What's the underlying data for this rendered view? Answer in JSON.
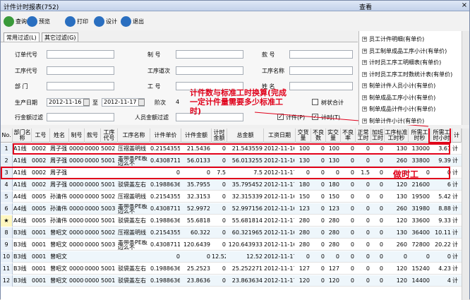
{
  "window": {
    "title": "计件计时报表(752)",
    "query_label": "查看",
    "close_glyph": "×"
  },
  "toolbar": [
    {
      "label": "查询",
      "icon": "search-icon",
      "color": "#3a9a3a"
    },
    {
      "label": "预览",
      "icon": "preview-icon",
      "color": "#2a6fc0"
    },
    {
      "label": "打印",
      "icon": "print-icon",
      "color": "#2a6fc0"
    },
    {
      "label": "设计",
      "icon": "design-icon",
      "color": "#2a6fc0"
    },
    {
      "label": "退出",
      "icon": "exit-icon",
      "color": "#2a6fc0"
    }
  ],
  "tabs": [
    "常用过滤(L)",
    "其它过滤(G)"
  ],
  "filters": {
    "order_no": "订单代号",
    "category": "制    号",
    "style": "款    号",
    "work_code": "工序代号",
    "process_order": "工序道次",
    "process_name": "工序名称",
    "dept": "部    门",
    "work_no": "工    号",
    "name": "姓    名",
    "prod_date": "生产日期",
    "date_from": "2012-11-16",
    "to": "至",
    "date_to": "2012-11-17",
    "shift": "阶次",
    "shift_value": "4",
    "line_total": "行金额过滤",
    "person_total": "人员金额过滤",
    "chk_sum": "树状合计",
    "chk_piece": "计件(P)",
    "chk_time": "计时(T)"
  },
  "annotation_top": "计件数与标准工时换算(完成一定计件量需要多少标准工时)",
  "annotation_row": "做时工",
  "report_list": [
    "员工计件明细(有单价)",
    "员工制单成品工序小计(有单价)",
    "计时员工序工明细表(有单价)",
    "计时员工序工时数统计表(有单价)",
    "制单计件人员小计(有单价)",
    "制单成品工序小计(有单价)",
    "制单成品计件小计(有单价)",
    "制单计件小计(有单价)"
  ],
  "columns": [
    "No.",
    "部门名称",
    "工号",
    "姓名",
    "制号",
    "款号",
    "工序代号",
    "工序名称",
    "计件单价",
    "计件金额",
    "计时金额",
    "总金额",
    "工资日期",
    "交货量",
    "不良数",
    "实交量",
    "不良率",
    "正常工时",
    "加班工时",
    "工序标准工时秒",
    "所需工时秒",
    "所需工时小时",
    "计"
  ],
  "rows": [
    [
      "1",
      "A1线",
      "0002",
      "周子强",
      "0000",
      "0000",
      "5002",
      "压褶盖明线",
      "0.21543559",
      "21.5436",
      "0",
      "21.543559",
      "2012-11-16",
      "100",
      "0",
      "100",
      "0",
      "0",
      "0",
      "130",
      "13000",
      "3.61",
      "计"
    ],
    [
      "2",
      "A1线",
      "0002",
      "周子强",
      "0000",
      "0000",
      "5001",
      "盖带条PE板边么不",
      "0.43087119",
      "56.0133",
      "0",
      "56.013255",
      "2012-11-16",
      "130",
      "0",
      "130",
      "0",
      "0",
      "0",
      "260",
      "33800",
      "9.39",
      "计"
    ],
    [
      "3",
      "A1线",
      "0002",
      "周子强",
      "",
      "",
      "",
      "",
      "0",
      "0",
      "7.5",
      "7.5",
      "2012-11-17",
      "0",
      "0",
      "0",
      "0",
      "1.5",
      "0",
      "0",
      "0",
      "0",
      "计"
    ],
    [
      "4",
      "A1线",
      "0002",
      "周子强",
      "0000",
      "0000",
      "5001",
      "驳袋盖左右",
      "0.19886362",
      "35.7955",
      "0",
      "35.795452",
      "2012-11-17",
      "180",
      "0",
      "180",
      "0",
      "0",
      "0",
      "120",
      "21600",
      "6",
      "计"
    ],
    [
      "5",
      "A4线",
      "0005",
      "孙清伟",
      "0000",
      "0000",
      "5002",
      "压褶盖明线",
      "0.21543559",
      "32.3153",
      "0",
      "32.315339",
      "2012-11-16",
      "150",
      "0",
      "150",
      "0",
      "0",
      "0",
      "130",
      "19500",
      "5.42",
      "计"
    ],
    [
      "6",
      "A4线",
      "0005",
      "孙清伟",
      "0000",
      "0000",
      "5003",
      "盖带条PE板边么不",
      "0.43087119",
      "52.9972",
      "0",
      "52.997156",
      "2012-11-16",
      "123",
      "0",
      "123",
      "0",
      "0",
      "0",
      "260",
      "31980",
      "8.88",
      "计"
    ],
    [
      "7",
      "A4线",
      "0005",
      "孙清伟",
      "0000",
      "0000",
      "5001",
      "驳袋盖左右",
      "0.19886362",
      "55.6818",
      "0",
      "55.681814",
      "2012-11-17",
      "280",
      "0",
      "280",
      "0",
      "0",
      "0",
      "120",
      "33600",
      "9.33",
      "计"
    ],
    [
      "8",
      "B3线",
      "0001",
      "曾昭文",
      "0000",
      "0000",
      "5002",
      "压褶盖明线",
      "0.21543559",
      "60.322",
      "0",
      "60.321965",
      "2012-11-16",
      "280",
      "0",
      "280",
      "0",
      "0",
      "0",
      "130",
      "36400",
      "10.11",
      "计"
    ],
    [
      "9",
      "B3线",
      "0001",
      "曾昭文",
      "0000",
      "0000",
      "5003",
      "盖带条PE板边么不",
      "0.43087119",
      "120.6439",
      "0",
      "120.643933",
      "2012-11-16",
      "280",
      "0",
      "280",
      "0",
      "0",
      "0",
      "260",
      "72800",
      "20.22",
      "计"
    ],
    [
      "10",
      "B3线",
      "0001",
      "曾昭文",
      "",
      "",
      "",
      "",
      "0",
      "0",
      "12.52",
      "12.52",
      "2012-11-17",
      "0",
      "0",
      "0",
      "0",
      "0",
      "0",
      "0",
      "0",
      "0",
      "计"
    ],
    [
      "11",
      "B3线",
      "0001",
      "曾昭文",
      "0000",
      "0000",
      "5001",
      "驳袋盖左右",
      "0.19886362",
      "25.2523",
      "0",
      "25.252271",
      "2012-11-17",
      "127",
      "0",
      "127",
      "0",
      "0",
      "0",
      "120",
      "15240",
      "4.23",
      "计"
    ],
    [
      "12",
      "B3线",
      "0001",
      "曾昭文",
      "0000",
      "0000",
      "5001",
      "驳袋盖左右",
      "0.19886362",
      "23.8636",
      "0",
      "23.863634",
      "2012-11-17",
      "120",
      "0",
      "120",
      "0",
      "0",
      "0",
      "120",
      "14400",
      "4",
      "计"
    ]
  ],
  "current_row_marker": "★",
  "accent_red": "#e0001a"
}
